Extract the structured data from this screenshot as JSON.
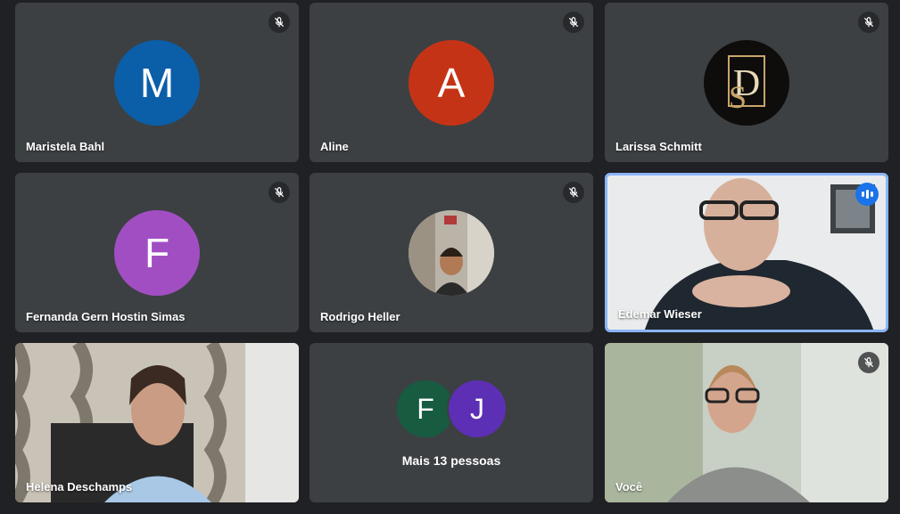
{
  "participants": [
    {
      "name": "Maristela Bahl",
      "initial": "M",
      "color": "#0b5ea8",
      "muted": true
    },
    {
      "name": "Aline",
      "initial": "A",
      "color": "#c53316",
      "muted": true
    },
    {
      "name": "Larissa Schmitt",
      "initial": "SD",
      "color": "#0e0d0c",
      "muted": true
    },
    {
      "name": "Fernanda Gern Hostin Simas",
      "initial": "F",
      "color": "#a24ec3",
      "muted": true
    },
    {
      "name": "Rodrigo Heller",
      "muted": true
    },
    {
      "name": "Edemar Wieser",
      "speaking": true
    },
    {
      "name": "Helena Deschamps"
    },
    {
      "more_label": "Mais 13 pessoas",
      "avatars": [
        {
          "initial": "F",
          "color": "#175b41"
        },
        {
          "initial": "J",
          "color": "#5c2fb5"
        }
      ]
    },
    {
      "name": "Você",
      "muted": true
    }
  ],
  "icons": {
    "mute": "microphone-off-icon",
    "speaking": "audio-level-icon"
  }
}
